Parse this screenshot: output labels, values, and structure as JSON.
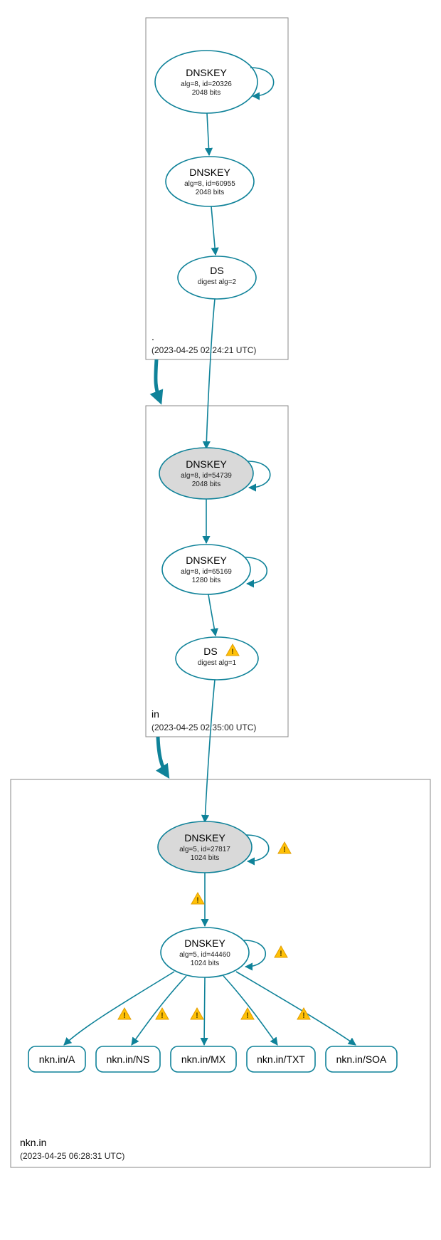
{
  "zones": {
    "root": {
      "name": ".",
      "timestamp": "(2023-04-25 02:24:21 UTC)"
    },
    "in": {
      "name": "in",
      "timestamp": "(2023-04-25 02:35:00 UTC)"
    },
    "nkn": {
      "name": "nkn.in",
      "timestamp": "(2023-04-25 06:28:31 UTC)"
    }
  },
  "nodes": {
    "root_ksk": {
      "title": "DNSKEY",
      "sub1": "alg=8, id=20326",
      "sub2": "2048 bits"
    },
    "root_zsk": {
      "title": "DNSKEY",
      "sub1": "alg=8, id=60955",
      "sub2": "2048 bits"
    },
    "root_ds": {
      "title": "DS",
      "sub1": "digest alg=2"
    },
    "in_ksk": {
      "title": "DNSKEY",
      "sub1": "alg=8, id=54739",
      "sub2": "2048 bits"
    },
    "in_zsk": {
      "title": "DNSKEY",
      "sub1": "alg=8, id=65169",
      "sub2": "1280 bits"
    },
    "in_ds": {
      "title": "DS",
      "sub1": "digest alg=1"
    },
    "nkn_ksk": {
      "title": "DNSKEY",
      "sub1": "alg=5, id=27817",
      "sub2": "1024 bits"
    },
    "nkn_zsk": {
      "title": "DNSKEY",
      "sub1": "alg=5, id=44460",
      "sub2": "1024 bits"
    }
  },
  "rrsets": {
    "a": "nkn.in/A",
    "ns": "nkn.in/NS",
    "mx": "nkn.in/MX",
    "txt": "nkn.in/TXT",
    "soa": "nkn.in/SOA"
  },
  "chart_data": {
    "type": "graph",
    "description": "DNSSEC authentication chain / DNSViz-style delegation graph",
    "zones": [
      {
        "id": "root",
        "label": ".",
        "timestamp": "2023-04-25 02:24:21 UTC"
      },
      {
        "id": "in",
        "label": "in",
        "timestamp": "2023-04-25 02:35:00 UTC"
      },
      {
        "id": "nkn",
        "label": "nkn.in",
        "timestamp": "2023-04-25 06:28:31 UTC"
      }
    ],
    "nodes": [
      {
        "id": "root_ksk",
        "zone": "root",
        "type": "DNSKEY",
        "alg": 8,
        "key_id": 20326,
        "bits": 2048,
        "ksk": true,
        "secure_entry_point": true
      },
      {
        "id": "root_zsk",
        "zone": "root",
        "type": "DNSKEY",
        "alg": 8,
        "key_id": 60955,
        "bits": 2048,
        "ksk": false
      },
      {
        "id": "root_ds",
        "zone": "root",
        "type": "DS",
        "digest_alg": 2
      },
      {
        "id": "in_ksk",
        "zone": "in",
        "type": "DNSKEY",
        "alg": 8,
        "key_id": 54739,
        "bits": 2048,
        "ksk": true
      },
      {
        "id": "in_zsk",
        "zone": "in",
        "type": "DNSKEY",
        "alg": 8,
        "key_id": 65169,
        "bits": 1280,
        "ksk": false
      },
      {
        "id": "in_ds",
        "zone": "in",
        "type": "DS",
        "digest_alg": 1,
        "warnings": true
      },
      {
        "id": "nkn_ksk",
        "zone": "nkn",
        "type": "DNSKEY",
        "alg": 5,
        "key_id": 27817,
        "bits": 1024,
        "ksk": true,
        "warnings": true
      },
      {
        "id": "nkn_zsk",
        "zone": "nkn",
        "type": "DNSKEY",
        "alg": 5,
        "key_id": 44460,
        "bits": 1024,
        "ksk": false,
        "warnings": true
      },
      {
        "id": "rr_a",
        "zone": "nkn",
        "type": "RRset",
        "name": "nkn.in/A"
      },
      {
        "id": "rr_ns",
        "zone": "nkn",
        "type": "RRset",
        "name": "nkn.in/NS"
      },
      {
        "id": "rr_mx",
        "zone": "nkn",
        "type": "RRset",
        "name": "nkn.in/MX"
      },
      {
        "id": "rr_txt",
        "zone": "nkn",
        "type": "RRset",
        "name": "nkn.in/TXT"
      },
      {
        "id": "rr_soa",
        "zone": "nkn",
        "type": "RRset",
        "name": "nkn.in/SOA"
      }
    ],
    "edges": [
      {
        "from": "root_ksk",
        "to": "root_ksk",
        "self_loop": true
      },
      {
        "from": "root_ksk",
        "to": "root_zsk"
      },
      {
        "from": "root_zsk",
        "to": "root_ds"
      },
      {
        "from": "root_ds",
        "to": "in_ksk"
      },
      {
        "from": "root",
        "to": "in",
        "delegation": true
      },
      {
        "from": "in_ksk",
        "to": "in_ksk",
        "self_loop": true
      },
      {
        "from": "in_ksk",
        "to": "in_zsk"
      },
      {
        "from": "in_zsk",
        "to": "in_zsk",
        "self_loop": true
      },
      {
        "from": "in_zsk",
        "to": "in_ds"
      },
      {
        "from": "in_ds",
        "to": "nkn_ksk"
      },
      {
        "from": "in",
        "to": "nkn",
        "delegation": true
      },
      {
        "from": "nkn_ksk",
        "to": "nkn_ksk",
        "self_loop": true,
        "warnings": true
      },
      {
        "from": "nkn_ksk",
        "to": "nkn_zsk",
        "warnings": true
      },
      {
        "from": "nkn_zsk",
        "to": "nkn_zsk",
        "self_loop": true,
        "warnings": true
      },
      {
        "from": "nkn_zsk",
        "to": "rr_a",
        "warnings": true
      },
      {
        "from": "nkn_zsk",
        "to": "rr_ns",
        "warnings": true
      },
      {
        "from": "nkn_zsk",
        "to": "rr_mx",
        "warnings": true
      },
      {
        "from": "nkn_zsk",
        "to": "rr_txt",
        "warnings": true
      },
      {
        "from": "nkn_zsk",
        "to": "rr_soa",
        "warnings": true
      }
    ]
  }
}
